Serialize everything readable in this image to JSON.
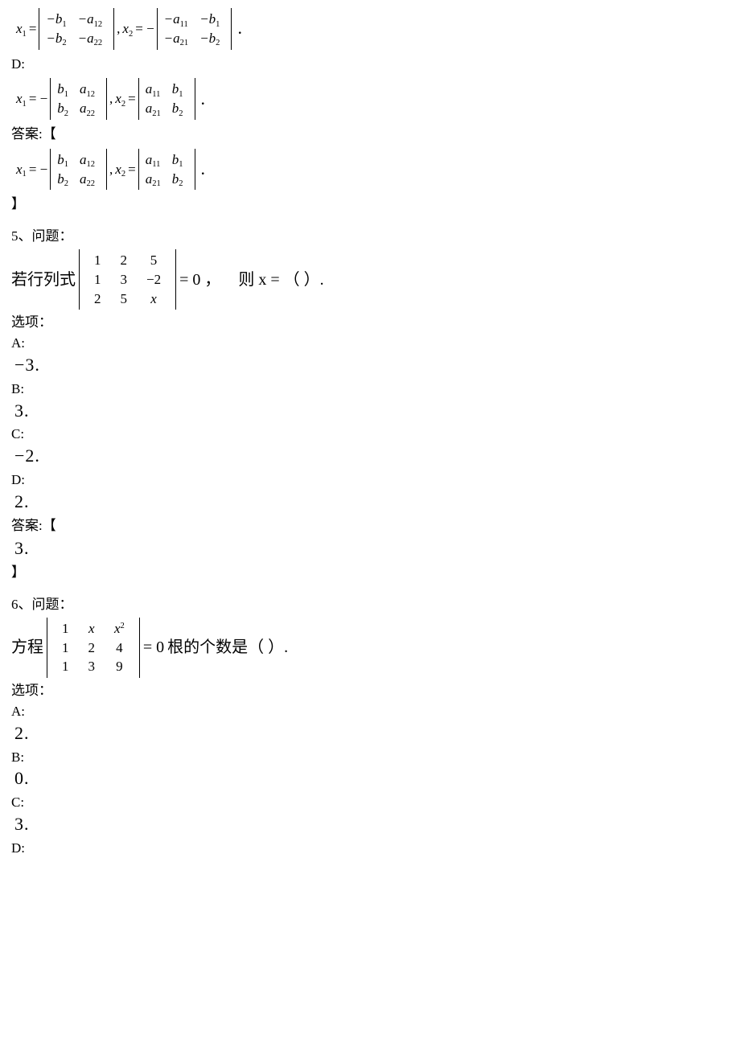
{
  "q4": {
    "optC_label": "D:",
    "optC_eq": {
      "lhs1": "x",
      "sub1": "1",
      "eq1": " = ",
      "m1": [
        [
          "−b",
          "1",
          "−a",
          "12"
        ],
        [
          "−b",
          "2",
          "−a",
          "22"
        ]
      ],
      "sep": ", ",
      "lhs2": "x",
      "sub2": "2",
      "eq2": " = − ",
      "m2": [
        [
          "−a",
          "11",
          "−b",
          "1"
        ],
        [
          "−a",
          "21",
          "−b",
          "2"
        ]
      ],
      "end": "."
    },
    "optD_eq": {
      "lhs1": "x",
      "sub1": "1",
      "eq1": " = − ",
      "m1": [
        [
          "b",
          "1",
          "a",
          "12"
        ],
        [
          "b",
          "2",
          "a",
          "22"
        ]
      ],
      "sep": ", ",
      "lhs2": "x",
      "sub2": "2",
      "eq2": " = ",
      "m2": [
        [
          "a",
          "11",
          "b",
          "1"
        ],
        [
          "a",
          "21",
          "b",
          "2"
        ]
      ],
      "end": "."
    },
    "ans_label": "答案:【",
    "ans_close": "】"
  },
  "q5": {
    "header": "5、问题：",
    "pre": "若行列式",
    "mat": [
      [
        "1",
        "2",
        "5"
      ],
      [
        "1",
        "3",
        "−2"
      ],
      [
        "2",
        "5",
        "x"
      ]
    ],
    "mid": " = 0 ，",
    "post": "则 x = （    ）.",
    "opts_label": "选项：",
    "A_lbl": "A:",
    "A": "−3.",
    "B_lbl": "B:",
    "B": "3.",
    "C_lbl": "C:",
    "C": "−2.",
    "D_lbl": "D:",
    "D": "2.",
    "ans_label": "答案:【",
    "ans": "3.",
    "ans_close": "】"
  },
  "q6": {
    "header": "6、问题：",
    "pre": "方程",
    "mat": [
      [
        "1",
        "x",
        "x²"
      ],
      [
        "1",
        "2",
        "4"
      ],
      [
        "1",
        "3",
        "9"
      ]
    ],
    "mid": " = 0 ",
    "post": "根的个数是（   ）.",
    "opts_label": "选项：",
    "A_lbl": "A:",
    "A": "2.",
    "B_lbl": "B:",
    "B": "0.",
    "C_lbl": "C:",
    "C": "3.",
    "D_lbl": "D:"
  },
  "chart_data": [
    {
      "type": "table",
      "title": "Question 5 determinant matrix (=0, solve for x)",
      "rows": [
        [
          1,
          2,
          5
        ],
        [
          1,
          3,
          -2
        ],
        [
          2,
          5,
          "x"
        ]
      ]
    },
    {
      "type": "table",
      "title": "Question 6 determinant matrix (=0, count roots)",
      "rows": [
        [
          1,
          "x",
          "x^2"
        ],
        [
          1,
          2,
          4
        ],
        [
          1,
          3,
          9
        ]
      ]
    }
  ]
}
